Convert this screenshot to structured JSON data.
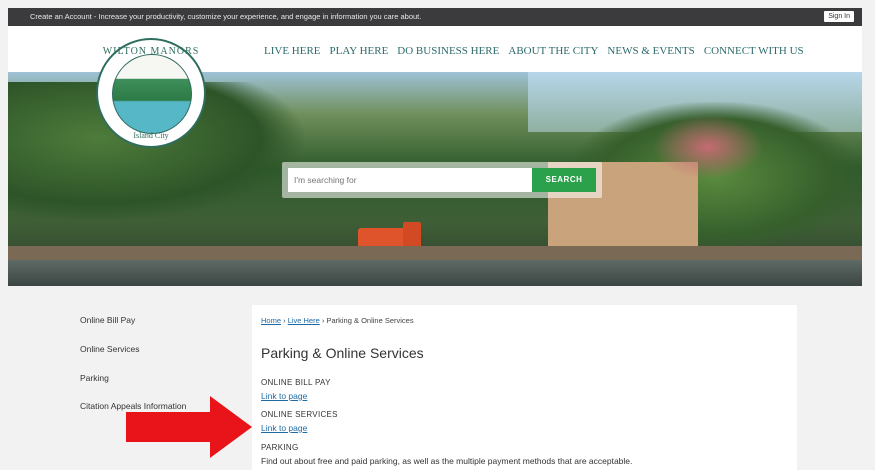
{
  "topbar": {
    "message": "Create an Account - Increase your productivity, customize your experience, and engage in information you care about.",
    "signin": "Sign In"
  },
  "logo": {
    "top_text": "WILTON MANORS",
    "bottom_text": "Island City"
  },
  "nav": [
    "LIVE HERE",
    "PLAY HERE",
    "DO BUSINESS HERE",
    "ABOUT THE CITY",
    "NEWS & EVENTS",
    "CONNECT WITH US"
  ],
  "search": {
    "placeholder": "I'm searching for",
    "button": "SEARCH"
  },
  "sidebar": [
    "Online Bill Pay",
    "Online Services",
    "Parking",
    "Citation Appeals Information"
  ],
  "breadcrumb": {
    "home": "Home",
    "sep1": " › ",
    "live": "Live Here",
    "sep2": " › ",
    "current": "Parking & Online Services"
  },
  "page": {
    "title": "Parking & Online Services",
    "section1_heading": "ONLINE BILL PAY",
    "section1_link": "Link to page",
    "section2_heading": "ONLINE SERVICES",
    "section2_link": "Link to page",
    "section3_heading": "PARKING",
    "section3_text": "Find out about free and paid parking, as well as the multiple payment methods that are acceptable."
  },
  "colors": {
    "accent_green": "#2aa14a",
    "nav_teal": "#2e6b6b",
    "arrow_red": "#e8141a",
    "link_blue": "#1d6aa5"
  }
}
